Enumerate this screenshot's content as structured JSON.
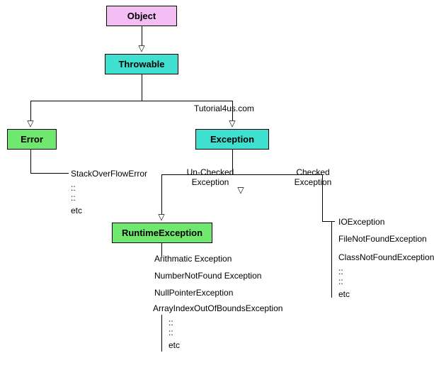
{
  "nodes": {
    "object": {
      "label": "Object",
      "color": "#f4bdf4"
    },
    "throwable": {
      "label": "Throwable",
      "color": "#40e0d0"
    },
    "error": {
      "label": "Error",
      "color": "#70e870"
    },
    "exception": {
      "label": "Exception",
      "color": "#40e0d0"
    },
    "runtime": {
      "label": "RuntimeException",
      "color": "#70e870"
    }
  },
  "labels": {
    "unchecked": "Un-Checked Exception",
    "checked": "Checked Exception",
    "watermark": "Tutorial4us.com"
  },
  "error_list": {
    "i0": "StackOverFlowError",
    "i1": "::",
    "i2": "::",
    "i3": "etc"
  },
  "runtime_list": {
    "i0": "Arithmatic Exception",
    "i1": "NumberNotFound Exception",
    "i2": "NullPointerException",
    "i3": "ArrayIndexOutOfBoundsException",
    "i4": "::",
    "i5": "::",
    "i6": "etc"
  },
  "checked_list": {
    "i0": "IOException",
    "i1": "FileNotFoundException",
    "i2": "ClassNotFoundException",
    "i3": "::",
    "i4": "::",
    "i5": "etc"
  },
  "glyph": {
    "down_arrow": "▽"
  }
}
